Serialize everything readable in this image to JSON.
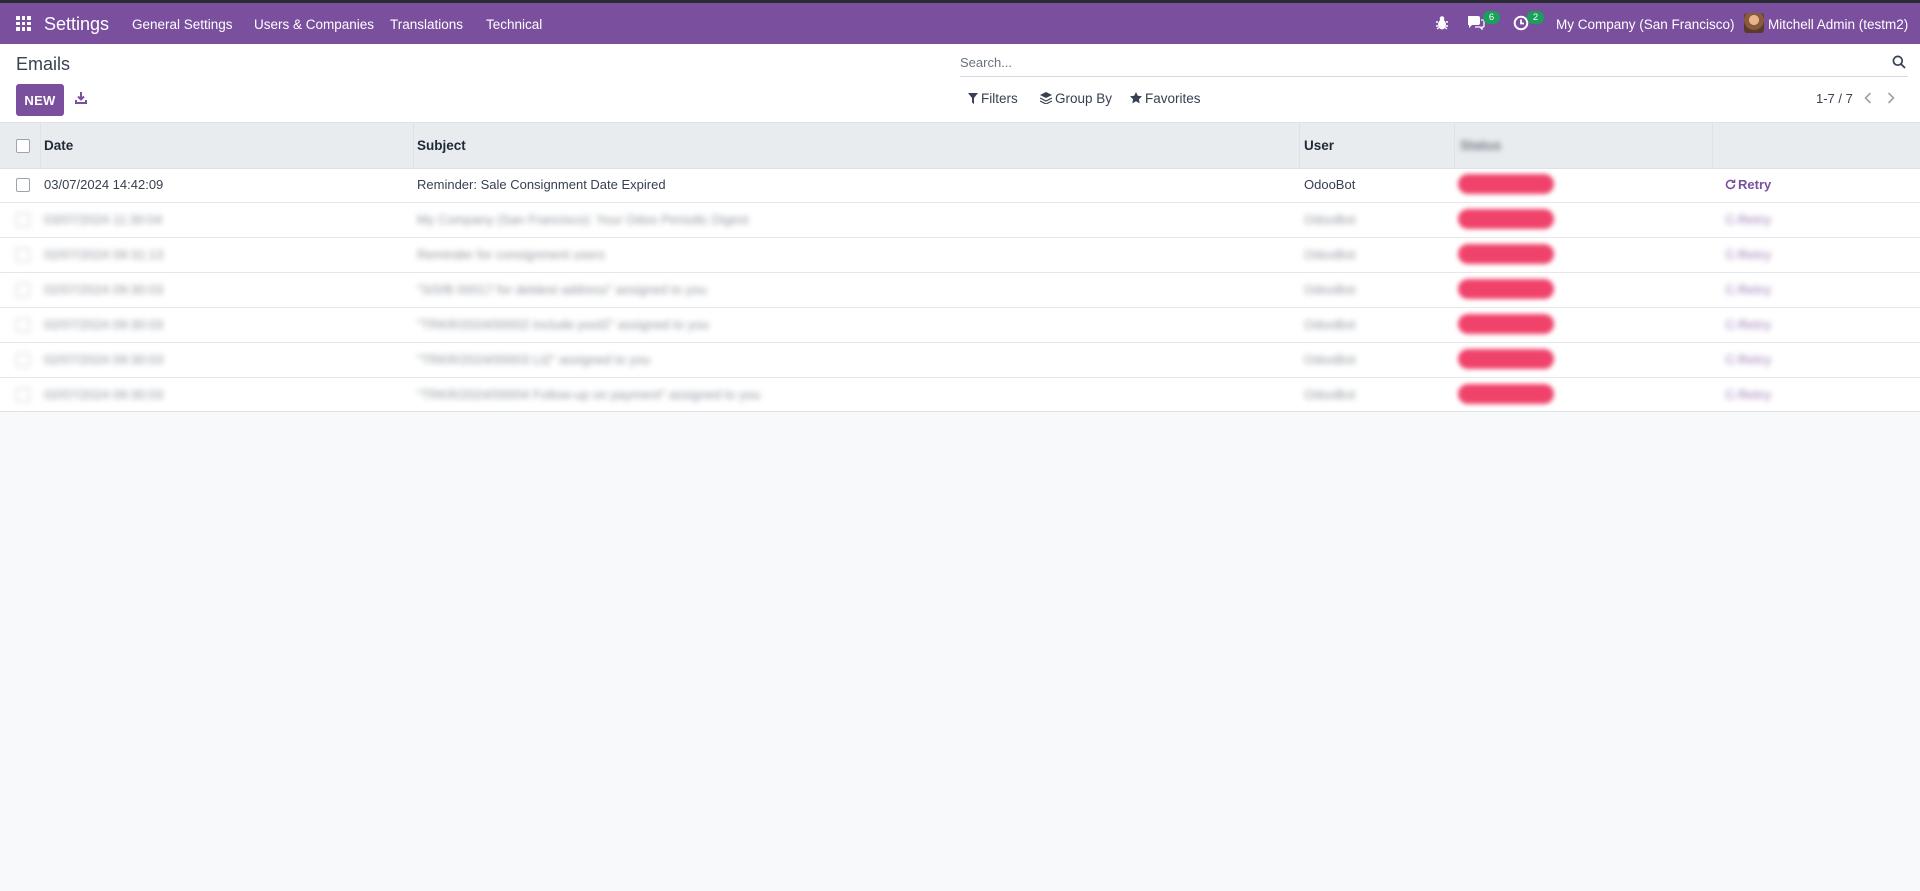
{
  "navbar": {
    "app_name": "Settings",
    "menu": [
      "General Settings",
      "Users & Companies",
      "Translations",
      "Technical"
    ],
    "messages_count": "6",
    "activities_count": "2",
    "company": "My Company (San Francisco)",
    "user": "Mitchell Admin (testm2)"
  },
  "control_panel": {
    "title": "Emails",
    "new_label": "NEW",
    "search_placeholder": "Search...",
    "filters_label": "Filters",
    "group_by_label": "Group By",
    "favorites_label": "Favorites",
    "pager": "1-7 / 7"
  },
  "table": {
    "columns": [
      "Date",
      "Subject",
      "User",
      "Status"
    ],
    "retry_label": "Retry",
    "rows": [
      {
        "date": "03/07/2024 14:42:09",
        "subject": "Reminder: Sale Consignment Date Expired",
        "user": "OdooBot"
      },
      {
        "date": "03/07/2024 11:30:04",
        "subject": "My Company (San Francisco): Your Odoo Periodic Digest",
        "user": "OdooBot"
      },
      {
        "date": "02/07/2024 09:31:13",
        "subject": "Reminder for consignment users",
        "user": "OdooBot"
      },
      {
        "date": "02/07/2024 09:30:03",
        "subject": "\"S/0/B 00017 for deldest address\" assigned to you",
        "user": "OdooBot"
      },
      {
        "date": "02/07/2024 09:30:03",
        "subject": "\"TRKR/2024/00002 include pool2\" assigned to you",
        "user": "OdooBot"
      },
      {
        "date": "02/07/2024 09:30:03",
        "subject": "\"TRKR/2024/00003 Lt2\" assigned to you",
        "user": "OdooBot"
      },
      {
        "date": "02/07/2024 09:30:03",
        "subject": "\"TRKR/2024/00004 Follow-up on payment\" assigned to you",
        "user": "OdooBot"
      }
    ]
  },
  "colors": {
    "brand": "#7a4f9e",
    "status_exception": "#f0436b",
    "badge": "#1aa05a"
  }
}
